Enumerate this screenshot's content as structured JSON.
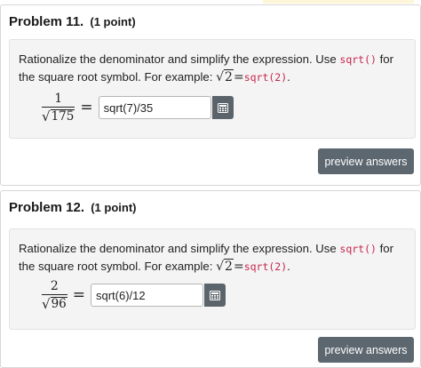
{
  "problems": [
    {
      "title": "Problem 11.",
      "points": "(1 point)",
      "instruction_a": "Rationalize the denominator and simplify the expression. Use",
      "code_sqrt": "sqrt()",
      "instruction_b": "for the square root symbol. For example:",
      "example_radicand": "2",
      "example_eq": "=",
      "example_code": "sqrt(2)",
      "example_end": ".",
      "numerator": "1",
      "denominator_radicand": "175",
      "equals": "=",
      "answer_value": "sqrt(7)/35",
      "preview_label": "preview answers"
    },
    {
      "title": "Problem 12.",
      "points": "(1 point)",
      "instruction_a": "Rationalize the denominator and simplify the expression. Use",
      "code_sqrt": "sqrt()",
      "instruction_b": "for the square root symbol. For example:",
      "example_radicand": "2",
      "example_eq": "=",
      "example_code": "sqrt(2)",
      "example_end": ".",
      "numerator": "2",
      "denominator_radicand": "96",
      "equals": "=",
      "answer_value": "sqrt(6)/12",
      "preview_label": "preview answers"
    }
  ],
  "icons": {
    "equation_editor": "grid-calculator-icon"
  },
  "colors": {
    "button_bg": "#5d6770",
    "code_text": "#c7254e",
    "panel_bg": "#f4f4f4"
  }
}
